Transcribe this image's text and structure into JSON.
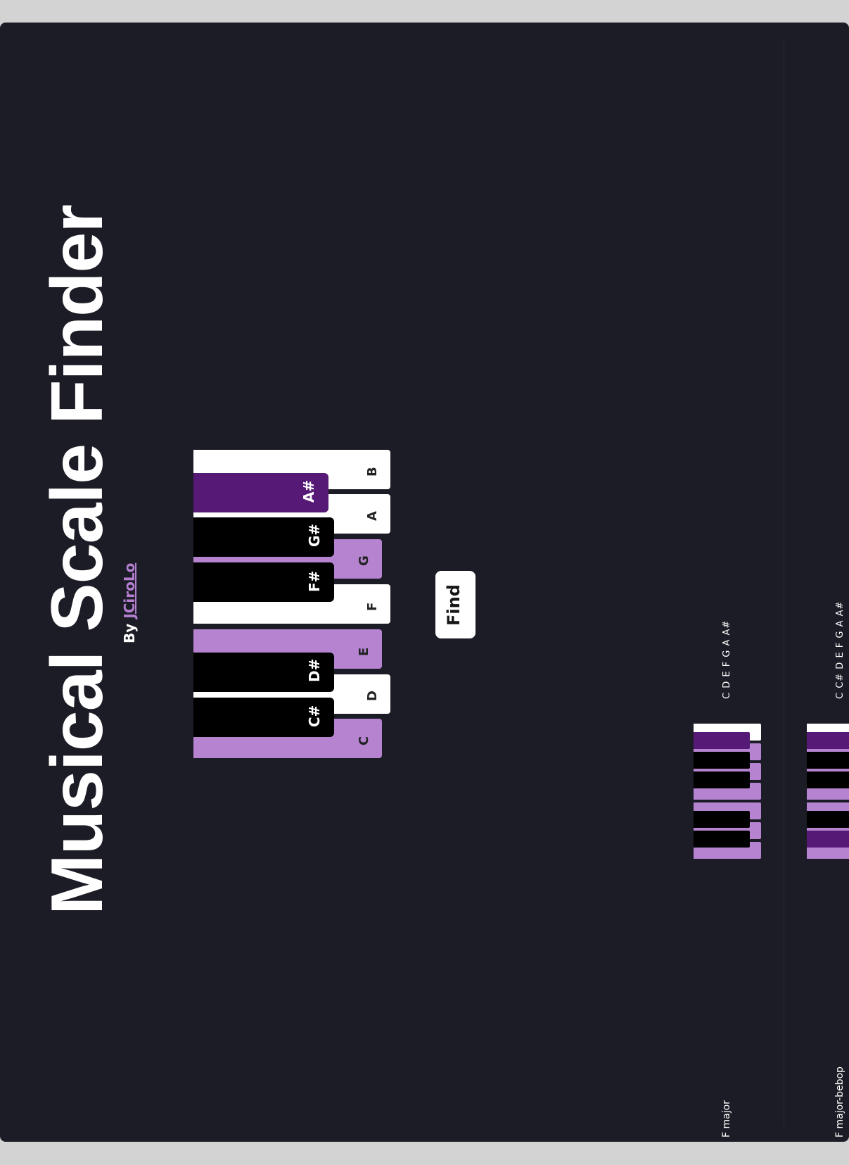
{
  "header": {
    "title": "Musical Scale Finder",
    "by_prefix": "By",
    "author": "JCiroLo"
  },
  "colors": {
    "background": "#1c1c26",
    "selected_white": "#b683d1",
    "selected_black": "#561a76",
    "accent": "#b47fd0"
  },
  "piano": {
    "white_keys": [
      {
        "note": "C",
        "selected": true
      },
      {
        "note": "D",
        "selected": false
      },
      {
        "note": "E",
        "selected": true
      },
      {
        "note": "F",
        "selected": false
      },
      {
        "note": "G",
        "selected": true
      },
      {
        "note": "A",
        "selected": false
      },
      {
        "note": "B",
        "selected": false
      }
    ],
    "black_keys": [
      {
        "note": "C#",
        "selected": false
      },
      {
        "note": "D#",
        "selected": false
      },
      {
        "note": "F#",
        "selected": false
      },
      {
        "note": "G#",
        "selected": false
      },
      {
        "note": "A#",
        "selected": true
      }
    ]
  },
  "find_button": {
    "label": "Find"
  },
  "results": [
    {
      "name": "F major",
      "notes": [
        "C",
        "D",
        "E",
        "F",
        "G",
        "A",
        "A#"
      ]
    },
    {
      "name": "F major-bebop",
      "notes": [
        "C",
        "C#",
        "D",
        "E",
        "F",
        "G",
        "A",
        "A#"
      ]
    }
  ]
}
